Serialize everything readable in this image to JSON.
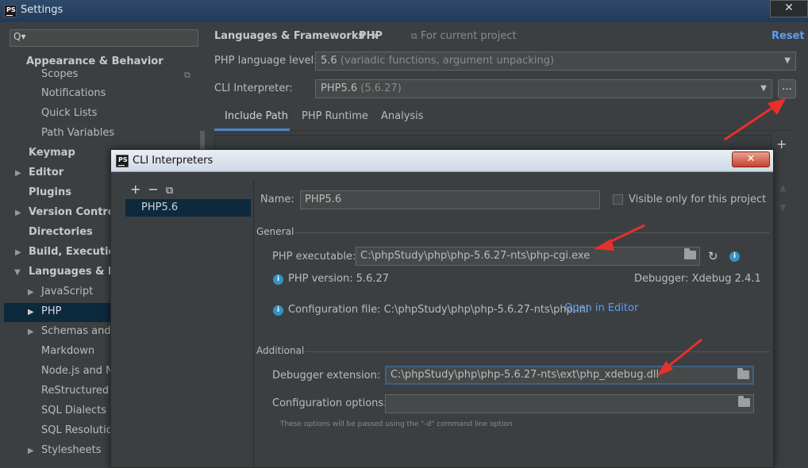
{
  "window": {
    "title": "Settings",
    "close_label": "✕",
    "logo": "PS"
  },
  "sidebar": {
    "search_icon": "Q▾",
    "items": [
      {
        "label": "Appearance & Behavior",
        "bold": true
      },
      {
        "label": "Scopes"
      },
      {
        "label": "Notifications"
      },
      {
        "label": "Quick Lists"
      },
      {
        "label": "Path Variables"
      },
      {
        "label": "Keymap",
        "bold": true
      },
      {
        "label": "Editor",
        "bold": true
      },
      {
        "label": "Plugins",
        "bold": true
      },
      {
        "label": "Version Control",
        "bold": true
      },
      {
        "label": "Directories",
        "bold": true
      },
      {
        "label": "Build, Execution,",
        "bold": true
      },
      {
        "label": "Languages & Fra",
        "bold": true
      },
      {
        "label": "JavaScript"
      },
      {
        "label": "PHP"
      },
      {
        "label": "Schemas and D"
      },
      {
        "label": "Markdown"
      },
      {
        "label": "Node.js and N"
      },
      {
        "label": "ReStructured T"
      },
      {
        "label": "SQL Dialects"
      },
      {
        "label": "SQL Resolution"
      },
      {
        "label": "Stylesheets"
      }
    ]
  },
  "header": {
    "breadcrumb_parent": "Languages & Frameworks",
    "breadcrumb_sep": "›",
    "breadcrumb_current": "PHP",
    "scope_note": "For current project",
    "reset_label": "Reset"
  },
  "php_settings": {
    "language_level_label": "PHP language level:",
    "language_level_value": "5.6",
    "language_level_detail": "(variadic functions, argument unpacking)",
    "cli_label": "CLI Interpreter:",
    "cli_value": "PHP5.6",
    "cli_detail": "(5.6.27)",
    "dots_label": "...",
    "tabs": [
      "Include Path",
      "PHP Runtime",
      "Analysis"
    ],
    "add_icon": "+"
  },
  "dialog": {
    "title": "CLI Interpreters",
    "close_label": "✕",
    "toolbar": {
      "add": "+",
      "remove": "−",
      "copy": "⧉"
    },
    "interpreters": [
      "PHP5.6"
    ],
    "name_label": "Name:",
    "name_value": "PHP5.6",
    "visible_only_label": "Visible only for this project",
    "general_title": "General",
    "executable_label": "PHP executable:",
    "executable_value": "C:\\phpStudy\\php\\php-5.6.27-nts\\php-cgi.exe",
    "version_text": "PHP version: 5.6.27",
    "debugger_text": "Debugger: Xdebug 2.4.1",
    "config_file_text": "Configuration file: C:\\phpStudy\\php\\php-5.6.27-nts\\php.ini",
    "open_editor_label": "Open in Editor",
    "additional_title": "Additional",
    "debugger_ext_label": "Debugger extension:",
    "debugger_ext_value": "C:\\phpStudy\\php\\php-5.6.27-nts\\ext\\php_xdebug.dll",
    "config_options_label": "Configuration options:",
    "config_options_value": "",
    "config_hint": "These options will be passed using the \"-d\" command line option"
  },
  "colors": {
    "accent": "#589df6",
    "selection": "#0d293e",
    "annotation_arrow": "#e8302a"
  }
}
